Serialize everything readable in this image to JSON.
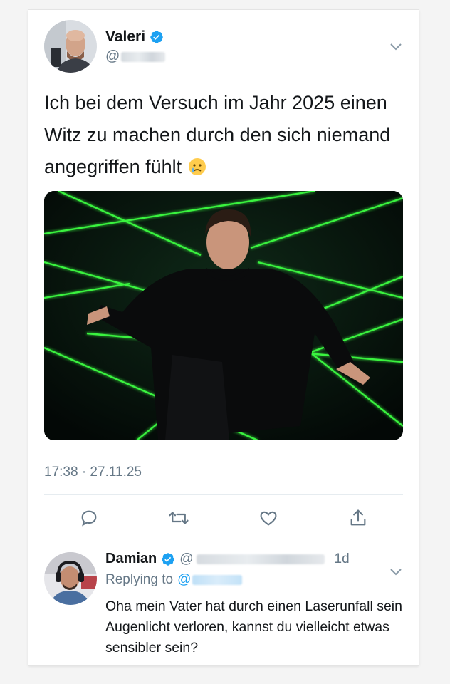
{
  "tweet": {
    "author": {
      "display_name": "Valeri",
      "handle_prefix": "@",
      "verified": true
    },
    "text": "Ich bei dem Versuch im Jahr 2025 einen Witz zu machen durch den sich niemand angegriffen fühlt",
    "text_emoji": "crying-face-emoji",
    "media": {
      "description_icon": "photo"
    },
    "timestamp": "17:38 · 27.11.25",
    "actions": [
      "reply-icon",
      "retweet-icon",
      "like-icon",
      "share-icon"
    ]
  },
  "reply": {
    "author": {
      "display_name": "Damian",
      "handle_prefix": "@",
      "verified": true
    },
    "time_ago": "1d",
    "replying_label": "Replying to",
    "replying_mention_prefix": "@",
    "text": "Oha mein Vater hat durch einen Laserunfall sein Augenlicht verloren, kannst du vielleicht etwas sensibler sein?"
  },
  "colors": {
    "verified_blue": "#1da1f2",
    "secondary_text": "#657786",
    "laser_green": "#39ff3a",
    "link_blue": "#1da1f2"
  }
}
